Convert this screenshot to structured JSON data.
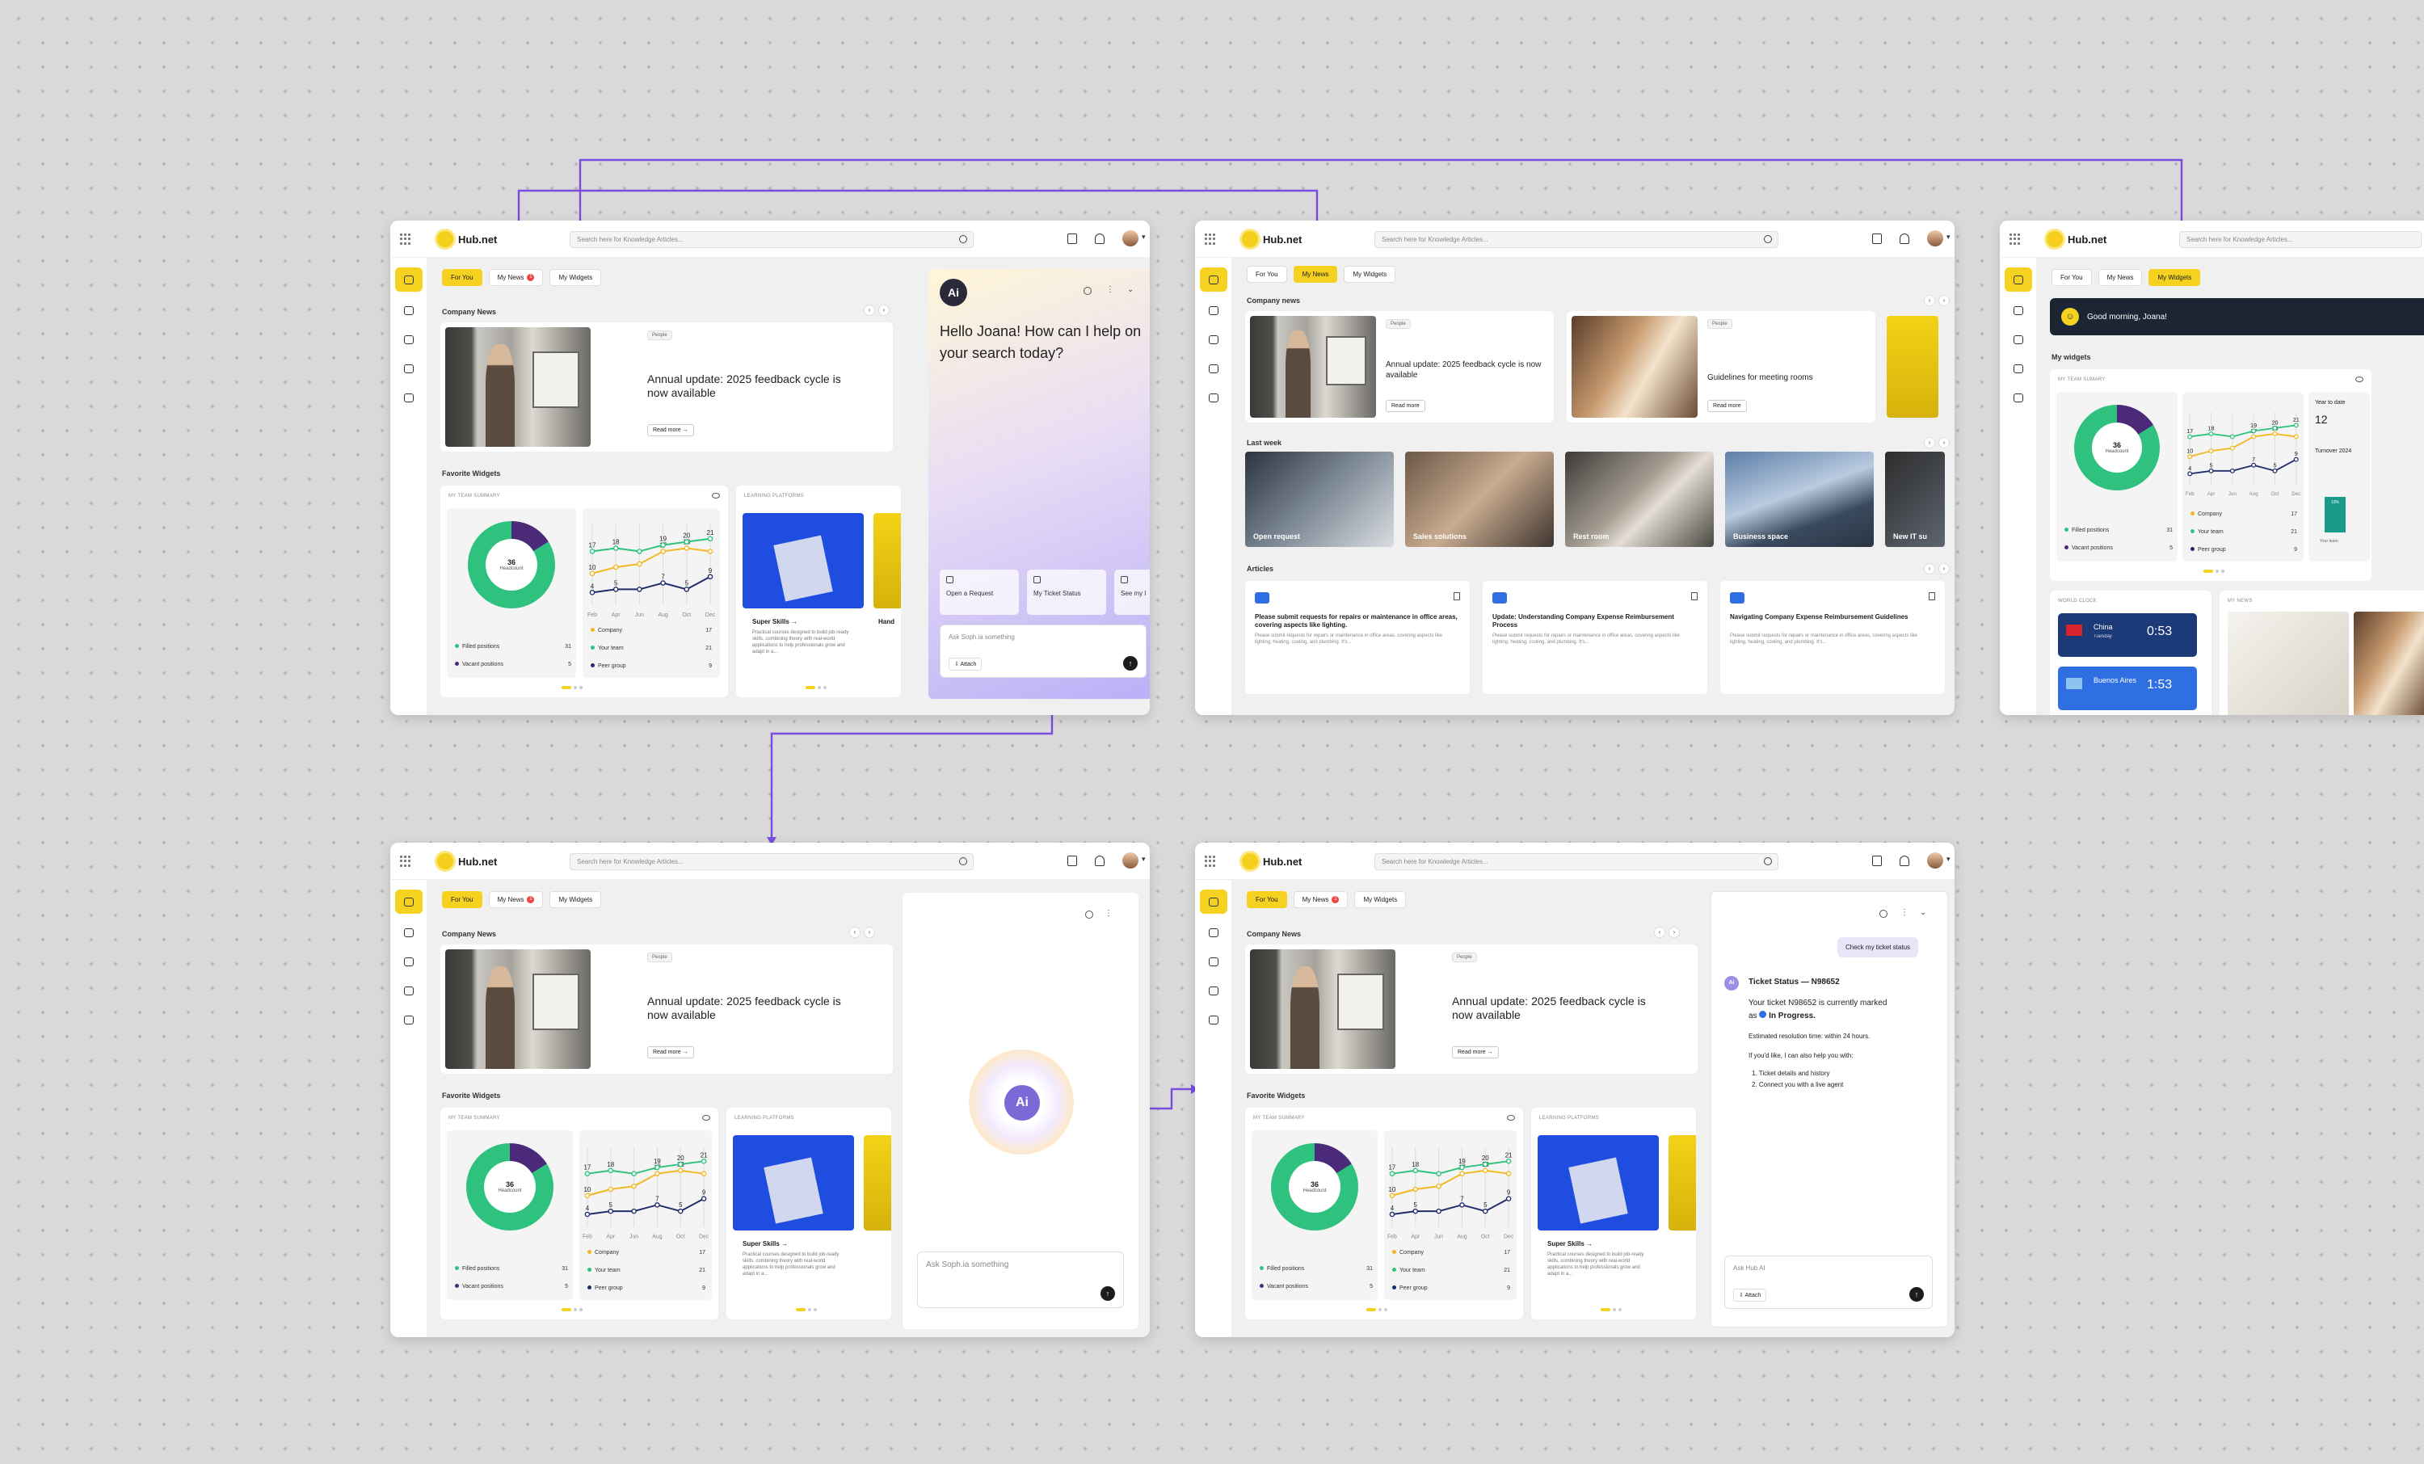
{
  "app": {
    "name": "Hub.net",
    "search_placeholder": "Search here for Knowledge Articles..."
  },
  "tabs": {
    "for_you": "For You",
    "my_news": "My News",
    "my_news_count": "1",
    "my_widgets": "My Widgets"
  },
  "sections": {
    "company_news": "Company News",
    "company_news_lower": "Company news",
    "favorite_widgets": "Favorite Widgets",
    "last_week": "Last week",
    "articles": "Articles",
    "my_widgets": "My widgets"
  },
  "news": {
    "tag": "People",
    "title": "Annual update: 2025 feedback cycle is now available",
    "read_more": "Read more",
    "second_title": "Guidelines for meeting rooms"
  },
  "team_summary": {
    "title": "MY TEAM SUMMARY",
    "title_alt": "MY TEAM SUMARY",
    "headcount_value": "36",
    "headcount_label": "Headcount",
    "filled_label": "Filled positions",
    "filled_value": "31",
    "vacant_label": "Vacant positions",
    "vacant_value": "5",
    "company_label": "Company",
    "company_value": "17",
    "team_label": "Your team",
    "team_value": "21",
    "peer_label": "Peer group",
    "peer_value": "9",
    "year_to_date_label": "Year to date",
    "year_to_date_value": "12",
    "turnover_label": "Turnover 2024",
    "turnover_pct": "10%",
    "your_team_short": "Your team"
  },
  "chart_data": {
    "type": "line",
    "categories": [
      "Feb",
      "Apr",
      "Jun",
      "Aug",
      "Oct",
      "Dec"
    ],
    "series": [
      {
        "name": "Company",
        "values": [
          10,
          12,
          13,
          17,
          18,
          17
        ]
      },
      {
        "name": "Your team",
        "values": [
          17,
          18,
          17,
          19,
          20,
          21
        ]
      },
      {
        "name": "Peer group",
        "values": [
          4,
          5,
          5,
          7,
          5,
          9
        ]
      }
    ],
    "colors": {
      "Company": "#f2b824",
      "Your team": "#2ec27e",
      "Peer group": "#1f2d6b"
    },
    "point_labels": [
      [
        "10",
        "",
        "",
        "17",
        "18",
        ""
      ],
      [
        "17",
        "18",
        "",
        "19",
        "20",
        "21"
      ],
      [
        "4",
        "5",
        "",
        "7",
        "5",
        "9"
      ]
    ]
  },
  "learning": {
    "title": "LEARNING PLATFORMS",
    "card_title": "Super Skills →",
    "card_text": "Practical courses designed to build job-ready skills, combining theory with real-world applications to help professionals grow and adapt in a...",
    "second_card_title": "Hand"
  },
  "ai": {
    "badge": "Ai",
    "greeting": "Hello Joana! How can I help on your search today?",
    "suggestions": [
      "Open a Request",
      "My Ticket Status",
      "See my l"
    ],
    "ask_placeholder": "Ask Soph.ia something",
    "attach": "Attach",
    "ask_hub": "Ask Hub AI",
    "user_message": "Check my ticket status",
    "reply_title": "Ticket Status — N98652",
    "reply_line1": "Your ticket N98652 is currently marked",
    "reply_status": "In Progress.",
    "reply_as": "as",
    "reply_eta": "Estimated resolution time: within 24 hours.",
    "reply_offer": "If you'd like, I can also help you with:",
    "reply_opt1": "1. Ticket details and history",
    "reply_opt2": "2. Connect you with a live agent"
  },
  "last_week": [
    "Open request",
    "Sales solutions",
    "Rest room",
    "Business space",
    "New IT su"
  ],
  "articles": [
    {
      "title": "Please submit requests for repairs or maintenance in office areas, covering aspects like lighting.",
      "text": "Please submit requests for repairs or maintenance in office areas, covering aspects like lighting, heating, cooling, and plumbing. It's..."
    },
    {
      "title": "Update: Understanding Company Expense Reimbursement Process",
      "text": "Please submit requests for repairs or maintenance in office areas, covering aspects like lighting, heating, cooling, and plumbing. It's..."
    },
    {
      "title": "Navigating Company Expense Reimbursement Guidelines",
      "text": "Please submit requests for repairs or maintenance in office areas, covering aspects like lighting, heating, cooling, and plumbing. It's..."
    }
  ],
  "widgets_screen": {
    "greeting": "Good morning, Joana!",
    "world_clock": "WORLD CLOCK",
    "clock_city": "China",
    "clock_day": "Tuesday",
    "clock_time": "0:53",
    "clock_city2": "Buenos Aires",
    "clock_time2": "1:53",
    "my_news": "MY NEWS"
  }
}
